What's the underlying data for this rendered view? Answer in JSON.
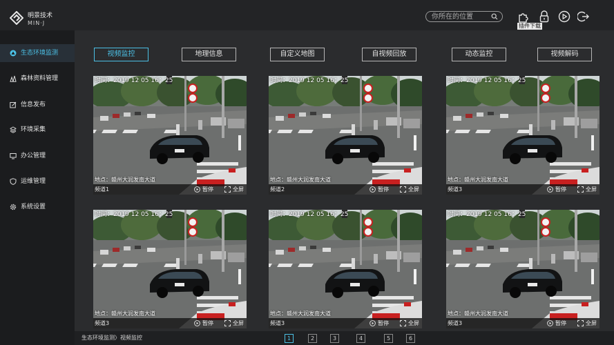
{
  "app": {
    "logo_name": "明景技术",
    "logo_sub": "MIN·J"
  },
  "header": {
    "search_placeholder": "你所在的位置",
    "plugin_label": "插件下载",
    "icons": [
      "plugin-icon",
      "lock-icon",
      "play-circle-icon",
      "logout-icon"
    ]
  },
  "sidebar": {
    "items": [
      {
        "label": "生态环境监测",
        "icon": "ecology-icon",
        "active": true
      },
      {
        "label": "森林资料管理",
        "icon": "forest-icon",
        "active": false
      },
      {
        "label": "信息发布",
        "icon": "edit-icon",
        "active": false
      },
      {
        "label": "环境采集",
        "icon": "layers-icon",
        "active": false
      },
      {
        "label": "办公管理",
        "icon": "monitor-icon",
        "active": false
      },
      {
        "label": "运维管理",
        "icon": "shield-icon",
        "active": false
      },
      {
        "label": "系统设置",
        "icon": "gear-icon",
        "active": false
      }
    ]
  },
  "tabs": [
    {
      "label": "视频监控",
      "active": true
    },
    {
      "label": "地理信息",
      "active": false
    },
    {
      "label": "自定义地图",
      "active": false
    },
    {
      "label": "自视频回放",
      "active": false
    },
    {
      "label": "动态监控",
      "active": false
    },
    {
      "label": "视频解码",
      "active": false
    }
  ],
  "videos": [
    {
      "time": "时间：2019 12 05 16：25",
      "location": "地点：赣州大润发南大道",
      "channel": "频道1",
      "pause": "暂停",
      "fullscreen": "全屏"
    },
    {
      "time": "时间：2019 12 05 16：25",
      "location": "地点：赣州大润发南大道",
      "channel": "频道2",
      "pause": "暂停",
      "fullscreen": "全屏"
    },
    {
      "time": "时间：2019 12 05 16：25",
      "location": "地点：赣州大润发南大道",
      "channel": "频道3",
      "pause": "暂停",
      "fullscreen": "全屏"
    },
    {
      "time": "时间：2019 12 05 16：25",
      "location": "地点：赣州大润发南大道",
      "channel": "频道3",
      "pause": "暂停",
      "fullscreen": "全屏"
    },
    {
      "time": "时间：2019 12 05 16：25",
      "location": "地点：赣州大润发南大道",
      "channel": "频道3",
      "pause": "暂停",
      "fullscreen": "全屏"
    },
    {
      "time": "时间：2019 12 05 16：25",
      "location": "地点：赣州大润发南大道",
      "channel": "频道3",
      "pause": "暂停",
      "fullscreen": "全屏"
    }
  ],
  "breadcrumb": {
    "root": "生态环境监测",
    "separator": "〉",
    "current": "视频监控"
  },
  "pagination": {
    "pages": [
      "1",
      "2",
      "3",
      "4",
      "5",
      "6"
    ],
    "current": "1"
  },
  "colors": {
    "accent": "#4cc1e6",
    "background": "#1b1c1e",
    "panel": "#2b2c2e"
  }
}
